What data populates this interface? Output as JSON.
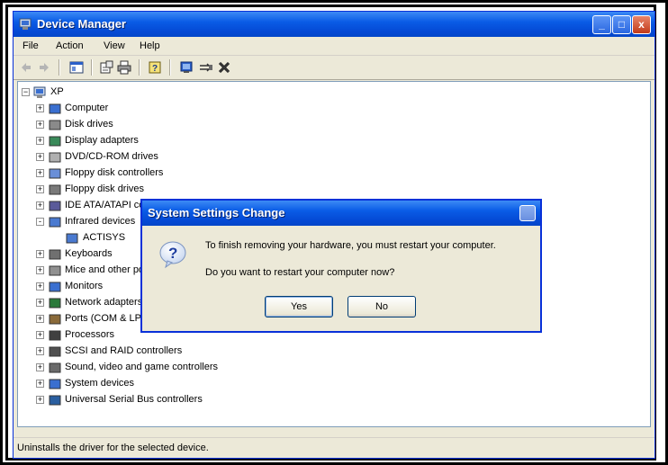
{
  "window": {
    "title": "Device Manager",
    "controls": {
      "minimize": "_",
      "maximize": "□",
      "close": "x"
    }
  },
  "menu": [
    "File",
    "Action",
    "View",
    "Help"
  ],
  "toolbar": {
    "icons": [
      "back-icon",
      "forward-icon",
      "show-hide-console-tree-icon",
      "properties-icon",
      "print-icon",
      "help-icon",
      "scan-hardware-icon",
      "update-driver-icon",
      "uninstall-icon"
    ]
  },
  "tree": {
    "root": "XP",
    "items": [
      {
        "label": "Computer",
        "expander": "+"
      },
      {
        "label": "Disk drives",
        "expander": "+"
      },
      {
        "label": "Display adapters",
        "expander": "+"
      },
      {
        "label": "DVD/CD-ROM drives",
        "expander": "+"
      },
      {
        "label": "Floppy disk controllers",
        "expander": "+"
      },
      {
        "label": "Floppy disk drives",
        "expander": "+"
      },
      {
        "label": "IDE ATA/ATAPI controllers",
        "expander": "+"
      },
      {
        "label": "Infrared devices",
        "expander": "-"
      },
      {
        "label": "ACTISYS",
        "expander": ""
      },
      {
        "label": "Keyboards",
        "expander": "+"
      },
      {
        "label": "Mice and other pointing devices",
        "expander": "+"
      },
      {
        "label": "Monitors",
        "expander": "+"
      },
      {
        "label": "Network adapters",
        "expander": "+"
      },
      {
        "label": "Ports (COM & LPT)",
        "expander": "+"
      },
      {
        "label": "Processors",
        "expander": "+"
      },
      {
        "label": "SCSI and RAID controllers",
        "expander": "+"
      },
      {
        "label": "Sound, video and game controllers",
        "expander": "+"
      },
      {
        "label": "System devices",
        "expander": "+"
      },
      {
        "label": "Universal Serial Bus controllers",
        "expander": "+"
      }
    ]
  },
  "status": "Uninstalls the driver for the selected device.",
  "dialog": {
    "title": "System Settings Change",
    "message1": "To finish removing your hardware, you must restart your computer.",
    "message2": "Do you want to restart your computer now?",
    "yes": "Yes",
    "no": "No"
  },
  "colors": {
    "titlebar": "#0a5ce6",
    "face": "#ece9d8",
    "border": "#0831d9"
  }
}
